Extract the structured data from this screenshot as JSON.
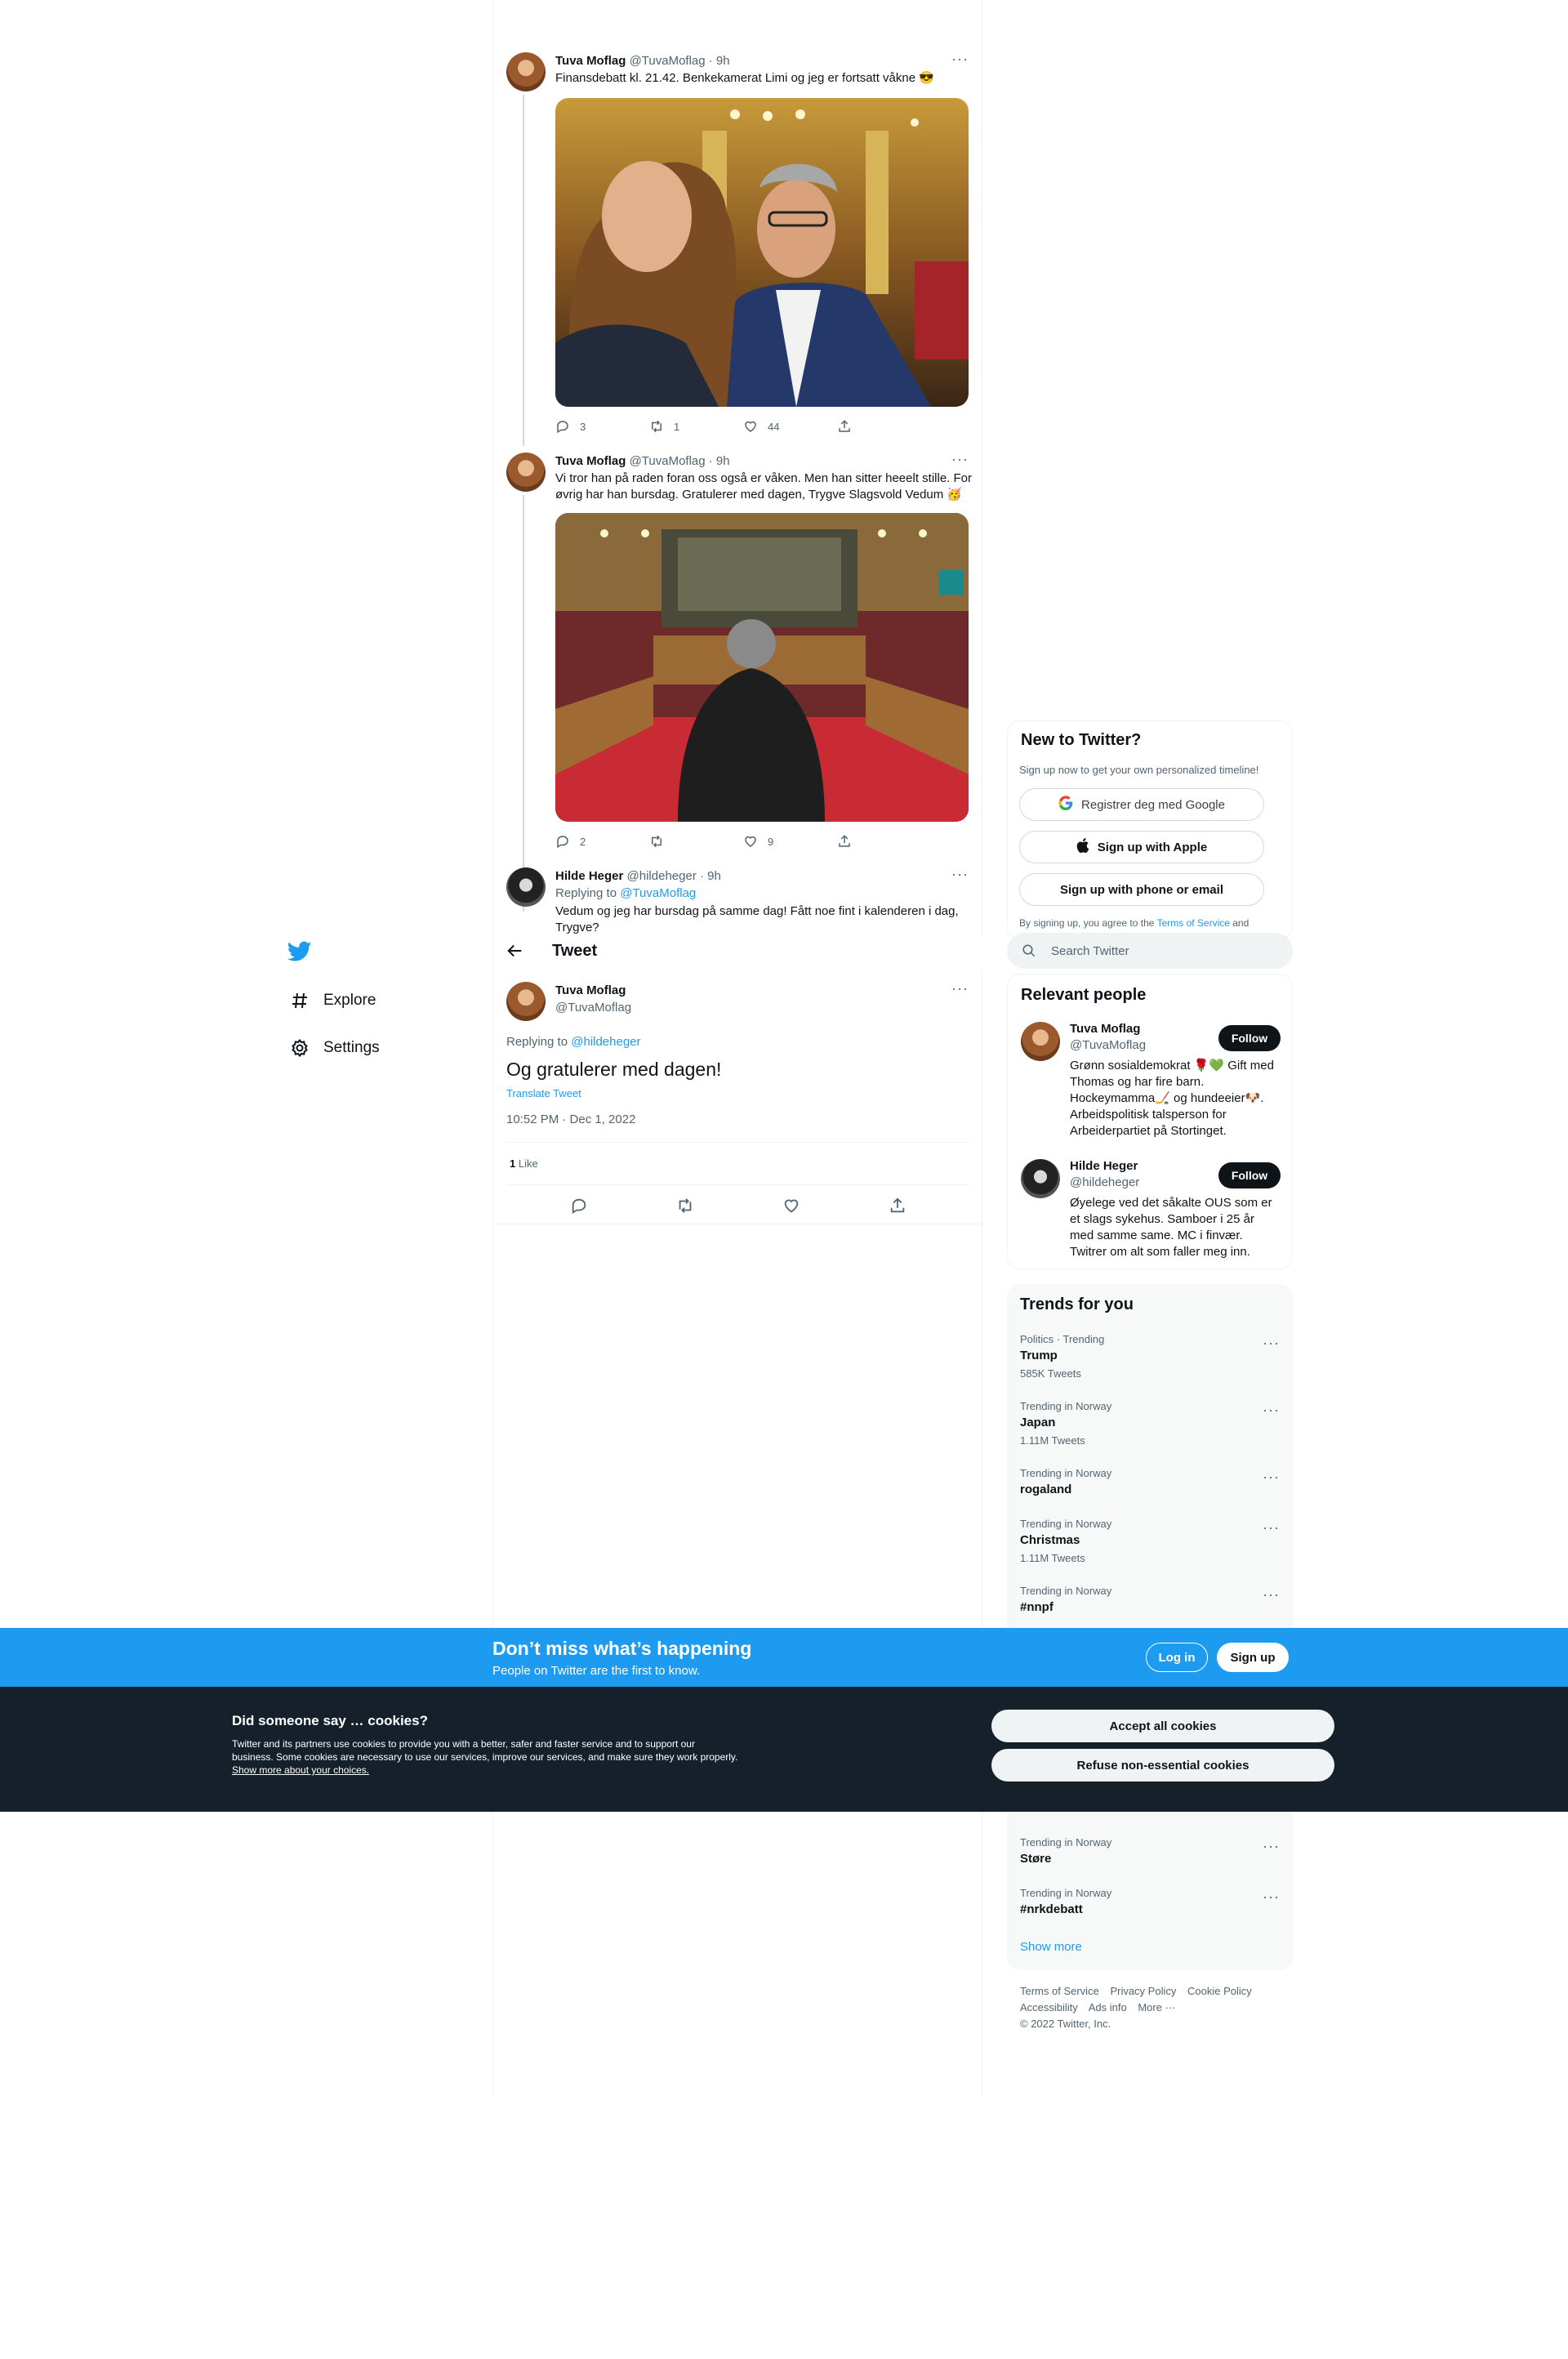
{
  "nav": {
    "explore_label": "Explore",
    "settings_label": "Settings"
  },
  "thread": [
    {
      "name": "Tuva Moflag",
      "handle": "@TuvaMoflag · 9h",
      "text": "Finansdebatt kl. 21.42. Benkekamerat Limi og jeg er fortsatt våkne 😎",
      "replies": "3",
      "retweets": "1",
      "likes": "44"
    },
    {
      "name": "Tuva Moflag",
      "handle": "@TuvaMoflag · 9h",
      "text": "Vi tror han på raden foran oss også er våken. Men han sitter heeelt stille. For øvrig har han bursdag. Gratulerer med dagen, Trygve Slagsvold Vedum 🥳",
      "replies": "2",
      "retweets": "",
      "likes": "9"
    },
    {
      "name": "Hilde Heger",
      "handle": "@hildeheger · 9h",
      "replying_prefix": "Replying to ",
      "replying_to": "@TuvaMoflag",
      "text": "Vedum og jeg har bursdag på samme dag! Fått noe fint i kalenderen i dag, Trygve?"
    }
  ],
  "tweet_header": {
    "title": "Tweet"
  },
  "focused_tweet": {
    "name": "Tuva Moflag",
    "handle": "@TuvaMoflag",
    "replying_prefix": "Replying to ",
    "replying_to": "@hildeheger",
    "text": "Og gratulerer med dagen!",
    "translate": "Translate Tweet",
    "timestamp": "10:52 PM · Dec 1, 2022",
    "like_count": "1",
    "like_label": " Like"
  },
  "signup_card": {
    "title": "New to Twitter?",
    "subtitle": "Sign up now to get your own personalized timeline!",
    "google_label": "Registrer deg med Google",
    "apple_label": "Sign up with Apple",
    "phone_label": "Sign up with phone or email",
    "terms_prefix": "By signing up, you agree to the ",
    "terms_link": "Terms of Service",
    "terms_suffix": " and"
  },
  "search": {
    "placeholder": "Search Twitter"
  },
  "relevant_people": {
    "title": "Relevant people",
    "follow_label": "Follow",
    "people": [
      {
        "name": "Tuva Moflag",
        "handle": "@TuvaMoflag",
        "bio": "Grønn sosialdemokrat 🌹💚 Gift med Thomas og har fire barn. Hockeymamma🏒 og hundeeier🐶. Arbeidspolitisk talsperson for Arbeiderpartiet på Stortinget."
      },
      {
        "name": "Hilde Heger",
        "handle": "@hildeheger",
        "bio": "Øyelege ved det såkalte OUS som er et slags sykehus. Samboer i 25 år med samme same. MC i finvær. Twitrer om alt som faller meg inn."
      }
    ]
  },
  "trends": {
    "title": "Trends for you",
    "items": [
      {
        "meta": "Politics · Trending",
        "name": "Trump",
        "count": "585K Tweets"
      },
      {
        "meta": "Trending in Norway",
        "name": "Japan",
        "count": "1.11M Tweets"
      },
      {
        "meta": "Trending in Norway",
        "name": "rogaland",
        "count": ""
      },
      {
        "meta": "Trending in Norway",
        "name": "Christmas",
        "count": "1.11M Tweets"
      },
      {
        "meta": "Trending in Norway",
        "name": "#nnpf",
        "count": ""
      },
      {
        "meta": "Trending in Norway",
        "name": "Støre",
        "count": ""
      },
      {
        "meta": "Trending in Norway",
        "name": "#nrkdebatt",
        "count": ""
      }
    ],
    "show_more": "Show more"
  },
  "footer": {
    "links": [
      "Terms of Service",
      "Privacy Policy",
      "Cookie Policy",
      "Accessibility",
      "Ads info",
      "More ···"
    ],
    "copyright": "© 2022 Twitter, Inc."
  },
  "banner": {
    "title": "Don’t miss what’s happening",
    "subtitle": "People on Twitter are the first to know.",
    "login_label": "Log in",
    "signup_label": "Sign up"
  },
  "cookie_banner": {
    "title": "Did someone say … cookies?",
    "description": "Twitter and its partners use cookies to provide you with a better, safer and faster service and to support our business. Some cookies are necessary to use our services, improve our services, and make sure they work properly. ",
    "link": "Show more about your choices.",
    "accept_label": "Accept all cookies",
    "refuse_label": "Refuse non-essential cookies"
  },
  "colors": {
    "brand_blue": "#1d9bf0",
    "cookie_bg": "#15202b",
    "text_primary": "#0f1419",
    "text_secondary": "#536471"
  }
}
